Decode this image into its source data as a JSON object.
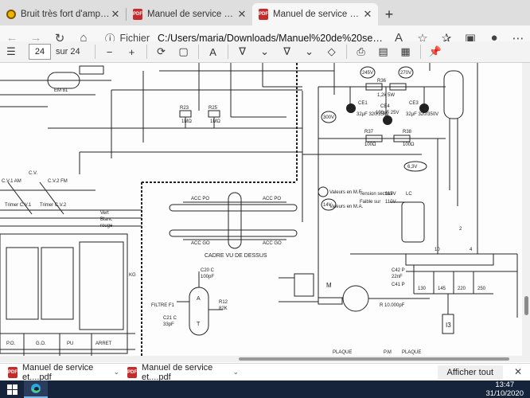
{
  "tabs": [
    {
      "title": "Bruit très fort d'amplification après",
      "icon": "edge-page-icon",
      "active": false
    },
    {
      "title": "Manuel de service et schéma (8)",
      "icon": "pdf-icon",
      "active": false
    },
    {
      "title": "Manuel de service et schéma (6)",
      "icon": "pdf-icon",
      "active": true
    }
  ],
  "address": {
    "scheme": "Fichier",
    "url": "C:/Users/maria/Downloads/Manuel%20de%20service%20et%..."
  },
  "pdf": {
    "page": "24",
    "page_count": "sur 24"
  },
  "schematic": {
    "labels": {
      "em81": "EM 81",
      "cv": "C.V.",
      "cv1": "C.V.1 AM",
      "cv2": "C.V.2 FM",
      "trimmer1": "Trimer C.V.1",
      "trimmer2": "Trimer C.V.2",
      "r23": "R23",
      "r23v": "1MΩ",
      "r25": "R25",
      "r25v": "1MΩ",
      "r36": "R36",
      "r36v": "1,2k 5W",
      "r37": "R37",
      "r37v": "100Ω",
      "r38": "R38",
      "r38v": "100Ω",
      "ce1": "CE1",
      "ce1v": "32μF 320/350V",
      "ce4": "CE4",
      "ce4v": "100μF 25V",
      "ce3": "CE3",
      "ce3v": "32μF 320/350V",
      "v245": "245V",
      "v270": "270V",
      "v300": "300V",
      "v14": "14V",
      "v63": "6,3V",
      "acc_po": "ACC PO",
      "acc_go": "ACC GO",
      "cadre": "CADRE VU DE DESSUS",
      "legend_mf": "Valeurs en M.F.",
      "legend_ma": "Valeurs en M.A.",
      "tension": "Tension secteur",
      "tension_v": "115V",
      "faible": "Faible sur",
      "faible_v": "110V",
      "lc": "LC",
      "c42": "C42 P",
      "c42v": "22nF",
      "c41": "C41 P",
      "filtre": "FILTRE F1",
      "c20": "C20 C",
      "c20v": "100pF",
      "c21": "C21 C",
      "c21v": "33pF",
      "r12": "R12",
      "r12v": "82K",
      "r10k": "R 10.000pF",
      "m": "M",
      "i3": "I3",
      "v130": "130",
      "v145": "145",
      "v220": "220",
      "v250": "250",
      "plaque": "PLAQUE",
      "pm": "P.M",
      "plaque2": "PLAQUE",
      "po": "P.O.",
      "go": "G.O.",
      "pu": "PU",
      "arret": "ARRET",
      "vert": "Vert",
      "blanc": "Blanc",
      "rouge": "rouge",
      "kg": "KG",
      "n_a": "A",
      "n_t": "T",
      "n10": "10",
      "n2": "2",
      "n4": "4"
    }
  },
  "downloads": [
    {
      "name": "Manuel de service et....pdf"
    },
    {
      "name": "Manuel de service et....pdf"
    }
  ],
  "downloads_bar": {
    "show_all": "Afficher tout"
  },
  "clock": {
    "time": "13:47",
    "date": "31/10/2020"
  }
}
